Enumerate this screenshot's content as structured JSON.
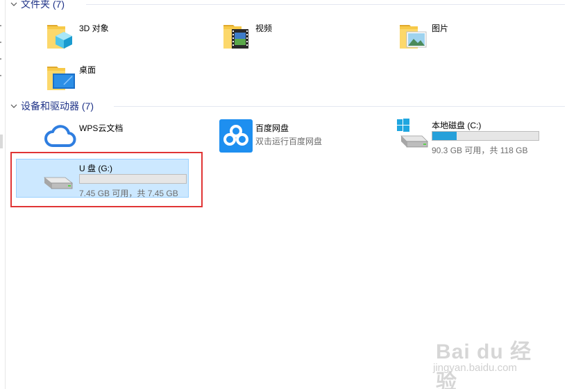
{
  "groups": {
    "folders": {
      "title": "文件夹 (7)"
    },
    "devices": {
      "title": "设备和驱动器 (7)"
    }
  },
  "folders": [
    {
      "label": "3D 对象",
      "icon": "3d-objects-folder-icon"
    },
    {
      "label": "视频",
      "icon": "videos-folder-icon"
    },
    {
      "label": "图片",
      "icon": "pictures-folder-icon"
    },
    {
      "label": "桌面",
      "icon": "desktop-folder-icon"
    }
  ],
  "devices": {
    "wps": {
      "label": "WPS云文档",
      "icon": "wps-cloud-icon"
    },
    "baidu": {
      "label": "百度网盘",
      "sub": "双击运行百度网盘",
      "icon": "baidu-netdisk-icon"
    },
    "c_drive": {
      "label": "本地磁盘 (C:)",
      "capacity": "90.3 GB 可用，共 118 GB",
      "used_fraction": 0.23,
      "icon": "windows-drive-icon"
    },
    "g_drive": {
      "label": "U 盘 (G:)",
      "capacity": "7.45 GB 可用，共 7.45 GB",
      "used_fraction": 0.0,
      "icon": "usb-drive-icon",
      "selected": true
    }
  },
  "colors": {
    "header_text": "#1e3287",
    "selection_bg": "#cce8ff",
    "selection_border": "#99d1ff",
    "bar_fill": "#26a0da",
    "annotation_red": "#e03434",
    "folder_yellow": "#f7c948"
  },
  "watermark": {
    "brand": "Bai du 经验",
    "url": "jingyan.baidu.com"
  }
}
